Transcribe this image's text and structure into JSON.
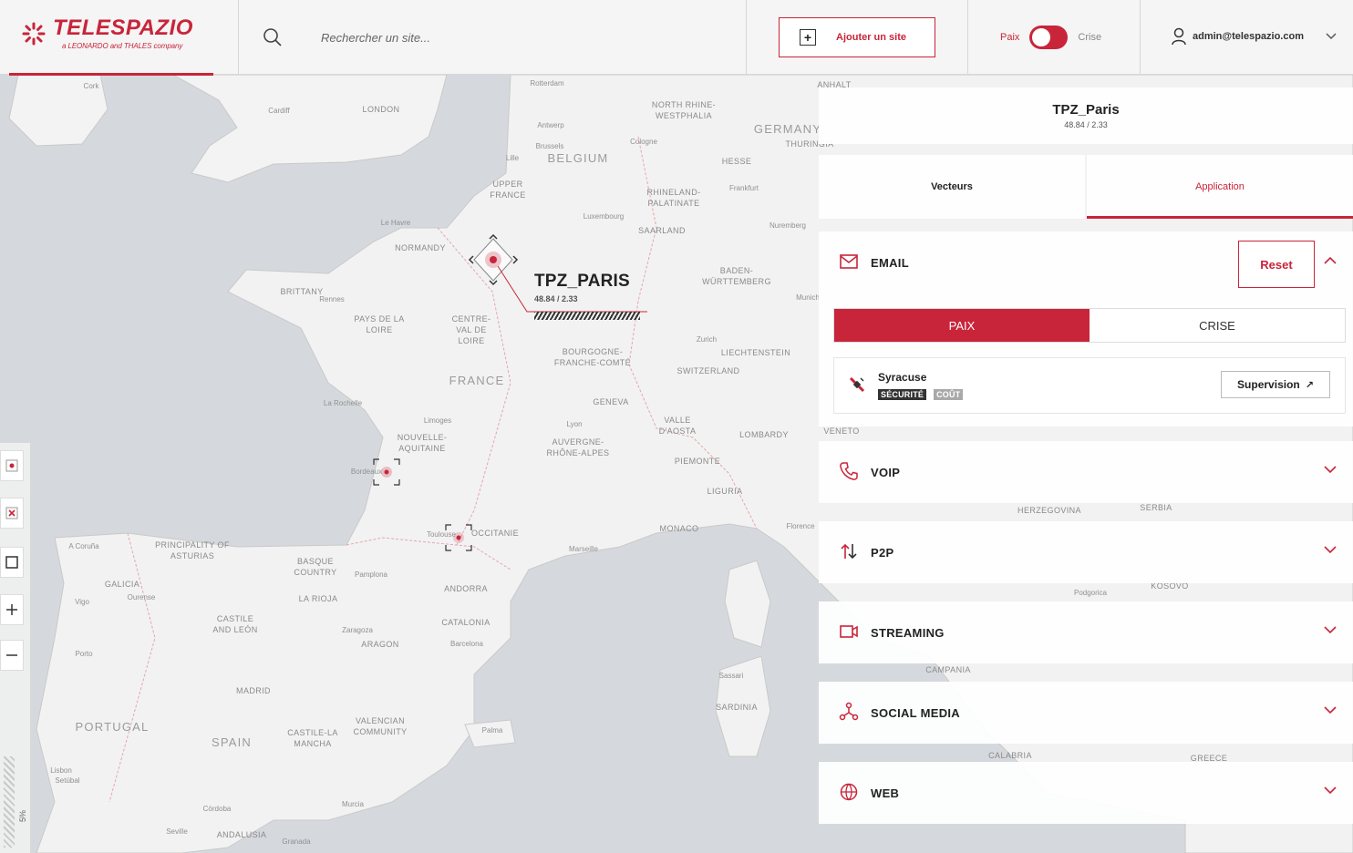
{
  "brand": {
    "name": "TELESPAZIO",
    "tagline": "a LEONARDO and THALES company",
    "accent": "#c8253a"
  },
  "header": {
    "search_placeholder": "Rechercher un site...",
    "add_site_label": "Ajouter un site",
    "mode_left": "Paix",
    "mode_right": "Crise",
    "mode_state": "Paix",
    "user_email": "admin@telespazio.com"
  },
  "map": {
    "zoom_label": "5%",
    "site_marker": {
      "name": "TPZ_PARIS",
      "coords": "48.84 / 2.33"
    },
    "labels": [
      "Cork",
      "Cardiff",
      "LONDON",
      "Rotterdam",
      "NORTH RHINE-WESTPHALIA",
      "GERMANY",
      "Antwerp",
      "Brussels",
      "Cologne",
      "Lille",
      "BELGIUM",
      "HESSE",
      "UPPER FRANCE",
      "RHINELAND-PALATINATE",
      "Frankfurt",
      "Luxembourg",
      "SAARLAND",
      "Nuremberg",
      "NORMANDY",
      "Le Havre",
      "BRITTANY",
      "Rennes",
      "BADEN-WÜRTTEMBERG",
      "PAYS DE LA LOIRE",
      "CENTRE-VAL DE LOIRE",
      "BOURGOGNE-FRANCHE-COMTÉ",
      "Zurich",
      "LIECHTENSTEIN",
      "FRANCE",
      "SWITZERLAND",
      "La Rochelle",
      "GENEVA",
      "Limoges",
      "NOUVELLE-AQUITAINE",
      "Lyon",
      "AUVERGNE-RHÔNE-ALPES",
      "VALLE D'AOSTA",
      "LOMBARDY",
      "Bordeaux",
      "PIEMONTE",
      "LIGURIA",
      "MONACO",
      "Toulouse",
      "OCCITANIE",
      "Marseille",
      "PRINCIPALITY OF ASTURIAS",
      "A Coruña",
      "BASQUE COUNTRY",
      "Pamplona",
      "GALICIA",
      "Ourense",
      "LA RIOJA",
      "ANDORRA",
      "CATALONIA",
      "Vigo",
      "CASTILE AND LEÓN",
      "Zaragoza",
      "ARAGON",
      "Barcelona",
      "Porto",
      "MADRID",
      "PORTUGAL",
      "SPAIN",
      "VALENCIAN COMMUNITY",
      "CASTILE-LA MANCHA",
      "Palma",
      "Lisbon",
      "Setúbal",
      "Murcia",
      "Córdoba",
      "Seville",
      "ANDALUSIA",
      "Granada",
      "SARDINIA",
      "Sassari",
      "Florence",
      "CAMPANIA",
      "CALABRIA",
      "HERZEGOVINA",
      "SERBIA",
      "KOSOVO",
      "Podgorica",
      "GREECE",
      "VENETO",
      "ANHALT",
      "THURINGIA",
      "Munich"
    ]
  },
  "panel": {
    "site_name": "TPZ_Paris",
    "site_coords": "48.84 / 2.33",
    "tabs": [
      {
        "label": "Vecteurs",
        "active": false
      },
      {
        "label": "Application",
        "active": true
      }
    ],
    "sections": [
      {
        "label": "EMAIL",
        "icon": "email-icon",
        "expanded": true
      },
      {
        "label": "VOIP",
        "icon": "phone-icon",
        "expanded": false
      },
      {
        "label": "P2P",
        "icon": "transfer-arrows-icon",
        "expanded": false
      },
      {
        "label": "STREAMING",
        "icon": "video-camera-icon",
        "expanded": false
      },
      {
        "label": "SOCIAL MEDIA",
        "icon": "share-network-icon",
        "expanded": false
      },
      {
        "label": "WEB",
        "icon": "globe-icon",
        "expanded": false
      }
    ],
    "email": {
      "reset_label": "Reset",
      "segment_on": "PAIX",
      "segment_off": "CRISE",
      "app": {
        "name": "Syracuse",
        "tag_primary": "SÉCURITÉ",
        "tag_secondary": "COÛT",
        "action_label": "Supervision",
        "action_icon": "external-arrow-icon"
      }
    }
  }
}
